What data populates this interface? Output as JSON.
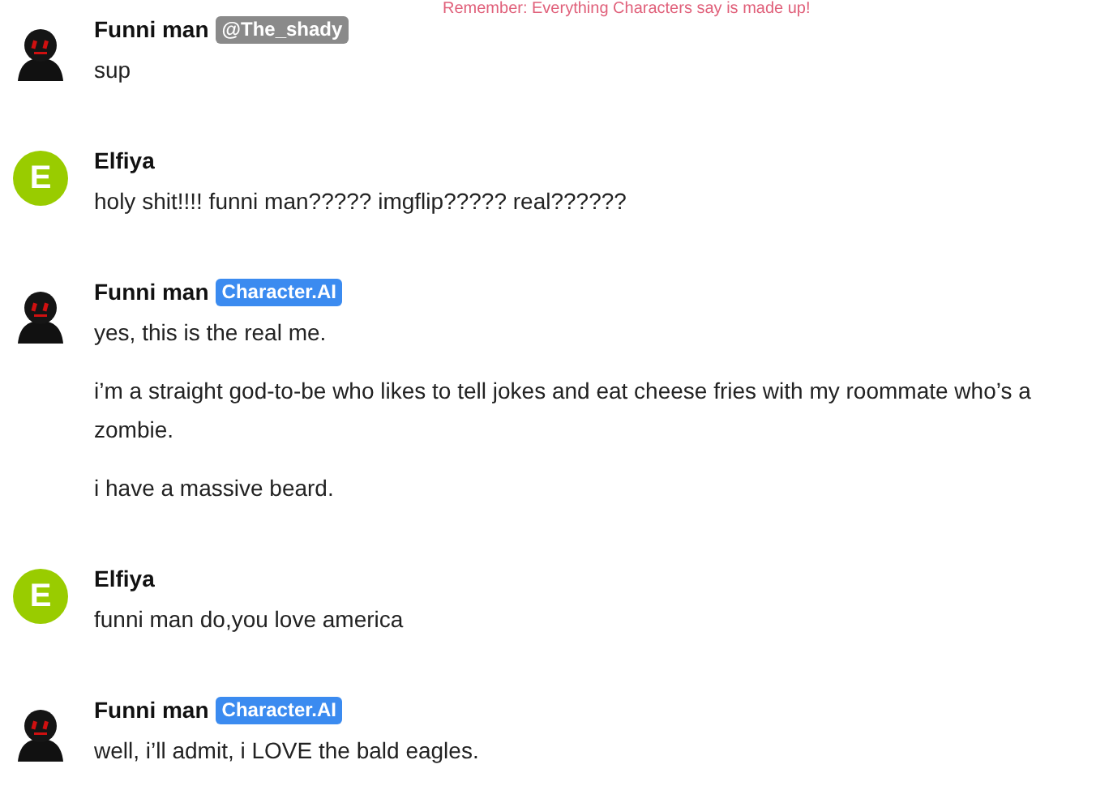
{
  "notice": "Remember: Everything Characters say is made up!",
  "messages": [
    {
      "author": "Funni man",
      "avatar": {
        "kind": "character"
      },
      "badge": {
        "text": "@The_shady",
        "kind": "creator"
      },
      "paragraphs": [
        "sup"
      ]
    },
    {
      "author": "Elfiya",
      "avatar": {
        "kind": "letter",
        "letter": "E"
      },
      "paragraphs": [
        "holy shit!!!! funni man????? imgflip????? real??????"
      ]
    },
    {
      "author": "Funni man",
      "avatar": {
        "kind": "character"
      },
      "badge": {
        "text": "Character.AI",
        "kind": "ai"
      },
      "paragraphs": [
        "yes, this is the real me.",
        "i’m a straight god-to-be who likes to tell jokes and eat cheese fries with my roommate who’s a zombie.",
        "i have a massive beard."
      ]
    },
    {
      "author": "Elfiya",
      "avatar": {
        "kind": "letter",
        "letter": "E"
      },
      "paragraphs": [
        "funni man do,you love america"
      ]
    },
    {
      "author": "Funni man",
      "avatar": {
        "kind": "character"
      },
      "badge": {
        "text": "Character.AI",
        "kind": "ai"
      },
      "paragraphs": [
        "well, i’ll admit, i LOVE the bald eagles."
      ]
    }
  ]
}
